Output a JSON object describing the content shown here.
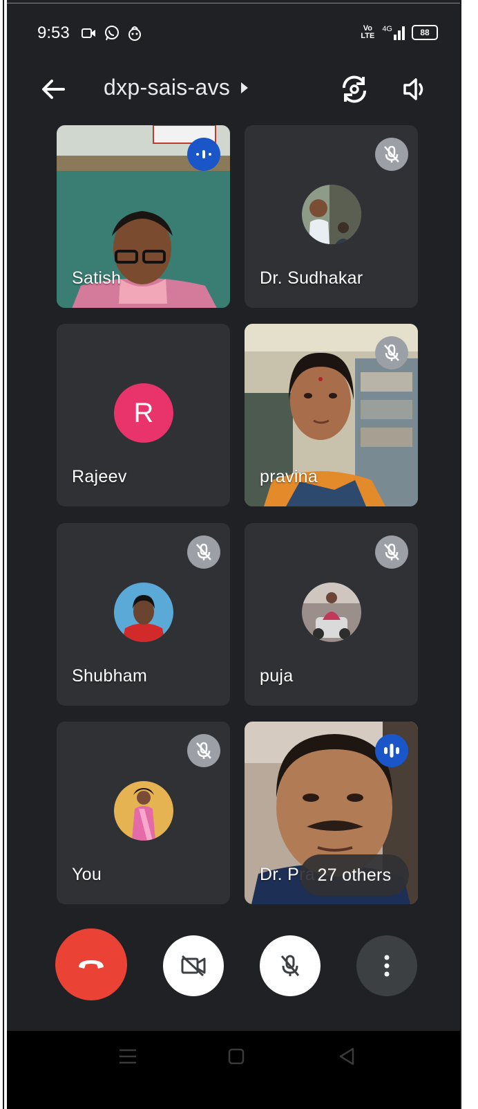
{
  "status_bar": {
    "time": "9:53",
    "network": "Vo LTE",
    "signal": "4G",
    "battery": "88"
  },
  "header": {
    "meeting_code": "dxp-sais-avs"
  },
  "participants": [
    {
      "name": "Satish",
      "state": "speaking",
      "view": "video"
    },
    {
      "name": "Dr. Sudhakar",
      "state": "muted",
      "view": "avatar-photo"
    },
    {
      "name": "Rajeev",
      "state": "unmuted",
      "view": "avatar-letter",
      "initial": "R",
      "avatar_color": "#e8336b"
    },
    {
      "name": "pravina",
      "state": "muted",
      "view": "video"
    },
    {
      "name": "Shubham",
      "state": "muted",
      "view": "avatar-photo"
    },
    {
      "name": "puja",
      "state": "muted",
      "view": "avatar-photo"
    },
    {
      "name": "You",
      "state": "muted",
      "view": "avatar-photo"
    },
    {
      "name": "Dr. Pra",
      "state": "speaking",
      "view": "video"
    }
  ],
  "others_chip": "27 others",
  "controls": [
    "end-call",
    "camera-off",
    "mic-off",
    "more-options"
  ],
  "colors": {
    "background": "#202124",
    "tile": "#303134",
    "end_call": "#ea4335",
    "speaking": "#1a56c8",
    "muted_badge": "#9aa0a6"
  }
}
